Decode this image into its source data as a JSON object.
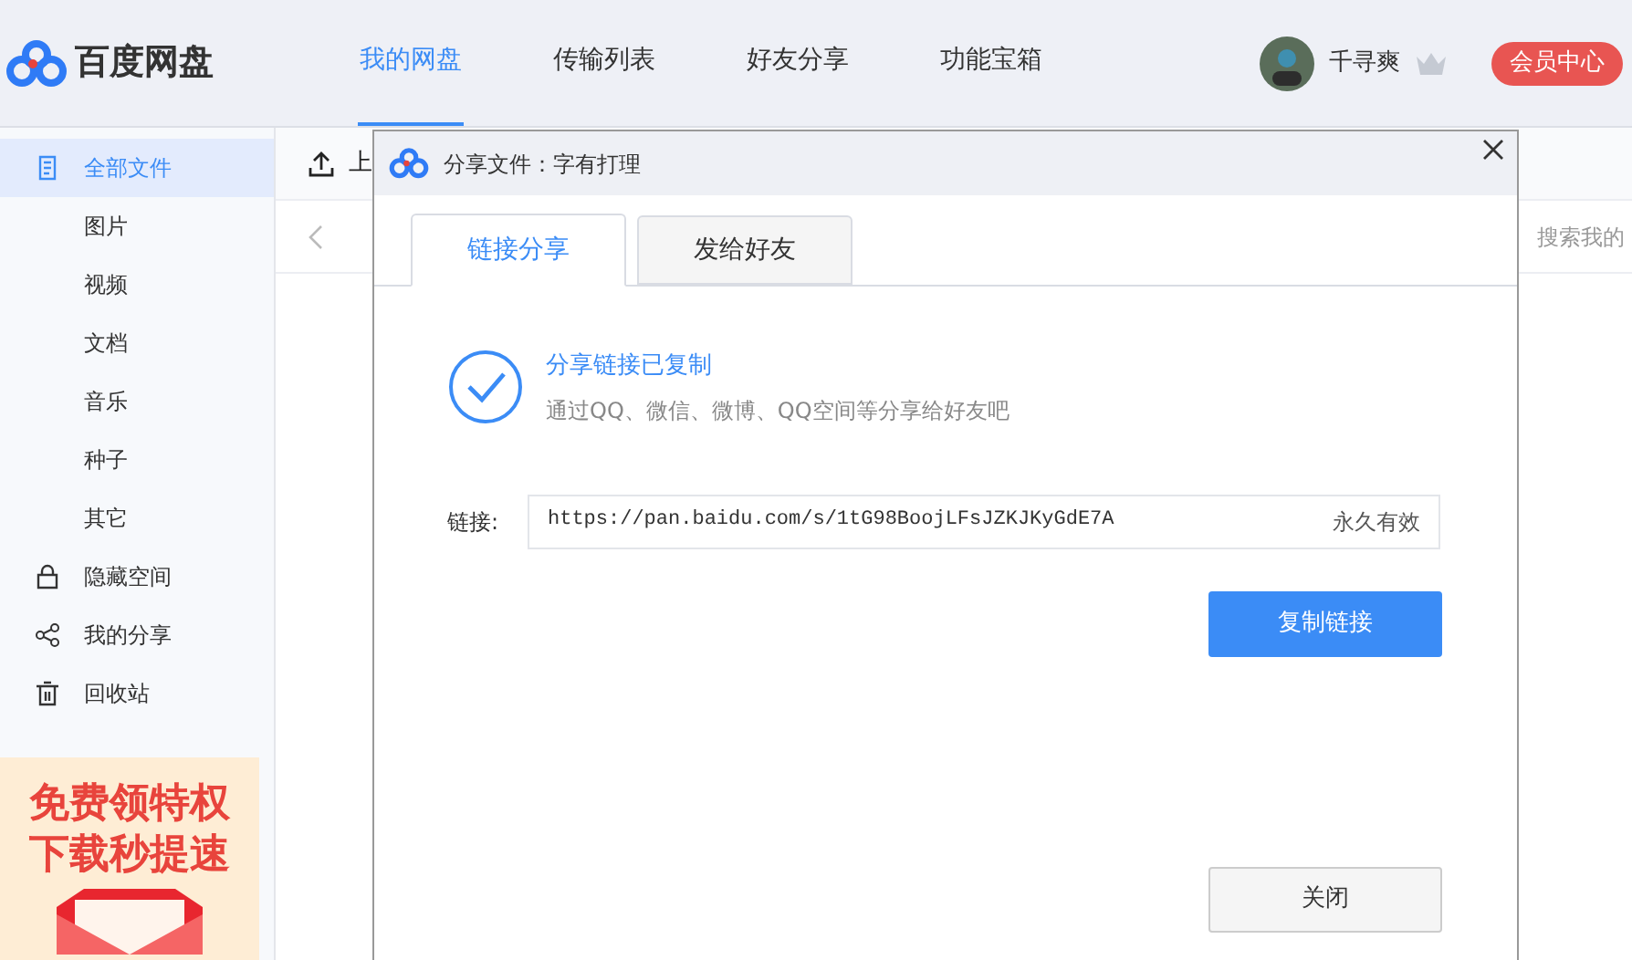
{
  "header": {
    "logo_text": "百度网盘",
    "nav": [
      {
        "label": "我的网盘",
        "selected": true
      },
      {
        "label": "传输列表",
        "selected": false
      },
      {
        "label": "好友分享",
        "selected": false
      },
      {
        "label": "功能宝箱",
        "selected": false
      }
    ],
    "username": "千寻爽",
    "vip_button": "会员中心"
  },
  "sidebar": {
    "items": [
      {
        "label": "全部文件",
        "kind": "document",
        "selected": true
      },
      {
        "label": "图片",
        "kind": "sub",
        "selected": false
      },
      {
        "label": "视频",
        "kind": "sub",
        "selected": false
      },
      {
        "label": "文档",
        "kind": "sub",
        "selected": false
      },
      {
        "label": "音乐",
        "kind": "sub",
        "selected": false
      },
      {
        "label": "种子",
        "kind": "sub",
        "selected": false
      },
      {
        "label": "其它",
        "kind": "sub",
        "selected": false
      },
      {
        "label": "隐藏空间",
        "kind": "lock",
        "selected": false
      },
      {
        "label": "我的分享",
        "kind": "share",
        "selected": false
      },
      {
        "label": "回收站",
        "kind": "trash",
        "selected": false
      }
    ],
    "promo": [
      "免费领特权",
      "下载秒提速"
    ]
  },
  "toolbar": {
    "upload_label": "上",
    "search_placeholder": "搜索我的"
  },
  "dialog": {
    "title": "分享文件：字有打理",
    "tabs": [
      {
        "label": "链接分享",
        "selected": true
      },
      {
        "label": "发给好友",
        "selected": false
      }
    ],
    "success_title": "分享链接已复制",
    "success_hint": "通过QQ、微信、微博、QQ空间等分享给好友吧",
    "link_label": "链接:",
    "link": "https://pan.baidu.com/s/1tG98BoojLFsJZKJKyGdE7A",
    "validity": "永久有效",
    "copy_button": "复制链接",
    "close_button": "关闭"
  }
}
